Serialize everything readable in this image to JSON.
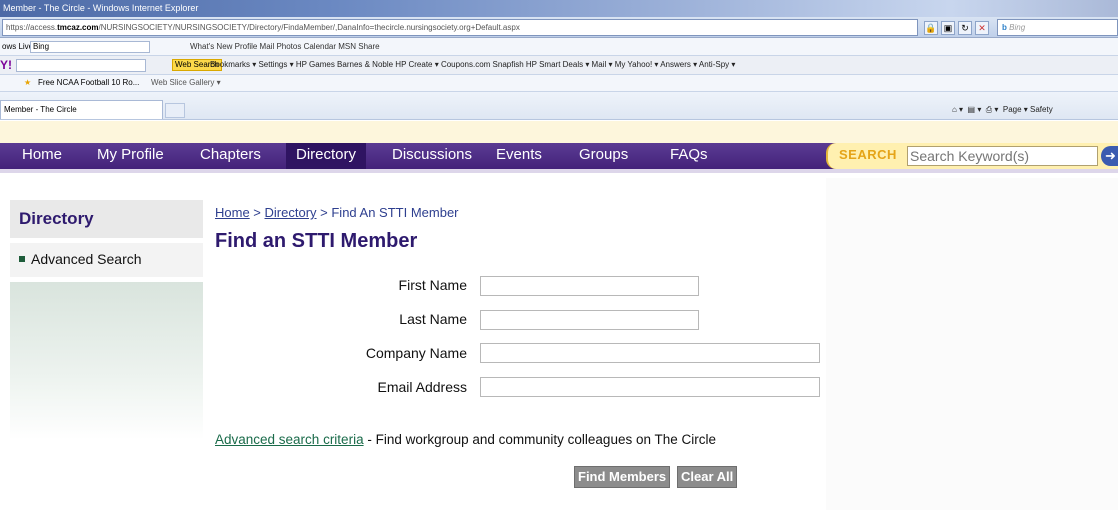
{
  "browser": {
    "title": "Member - The Circle - Windows Internet Explorer",
    "url_prefix": "https://access.",
    "url_domain": "tmcaz.com",
    "url_rest": "/NURSINGSOCIETY/NURSINGSOCIETY/Directory/FindaMember/,DanaInfo=thecircle.nursingsociety.org+Default.aspx",
    "bing_placeholder": "Bing",
    "live_label": "ows Live",
    "live_input": "Bing",
    "live_links": "What's New   Profile   Mail   Photos   Calendar   MSN   Share",
    "yahoo_websearch": "Web Search",
    "yahoo_links": "Bookmarks ▾  Settings ▾  HP Games  Barnes & Noble  HP Create ▾  Coupons.com  Snapfish  HP Smart Deals ▾  Mail ▾  My Yahoo! ▾  Answers ▾  Anti-Spy ▾",
    "fav1": "Free NCAA Football 10 Ro...",
    "fav2": "Web Slice Gallery ▾",
    "tab_title": "Member - The Circle",
    "tools": "Page ▾  Safety"
  },
  "nav": {
    "items": [
      "Home",
      "My Profile",
      "Chapters",
      "Directory",
      "Discussions",
      "Events",
      "Groups",
      "FAQs"
    ],
    "search_label": "SEARCH",
    "search_placeholder": "Search Keyword(s)"
  },
  "sidebar": {
    "title": "Directory",
    "item": "Advanced Search"
  },
  "breadcrumb": {
    "home": "Home",
    "sep1": " > ",
    "directory": "Directory",
    "sep2": " > ",
    "current": "Find An STTI Member"
  },
  "page_title": "Find an STTI Member",
  "form": {
    "first_name_label": "First Name",
    "last_name_label": "Last Name",
    "company_label": "Company Name",
    "email_label": "Email Address"
  },
  "advanced": {
    "link": "Advanced search criteria",
    "text": " - Find workgroup and community colleagues on The Circle"
  },
  "buttons": {
    "find": "Find Members",
    "clear": "Clear All"
  }
}
